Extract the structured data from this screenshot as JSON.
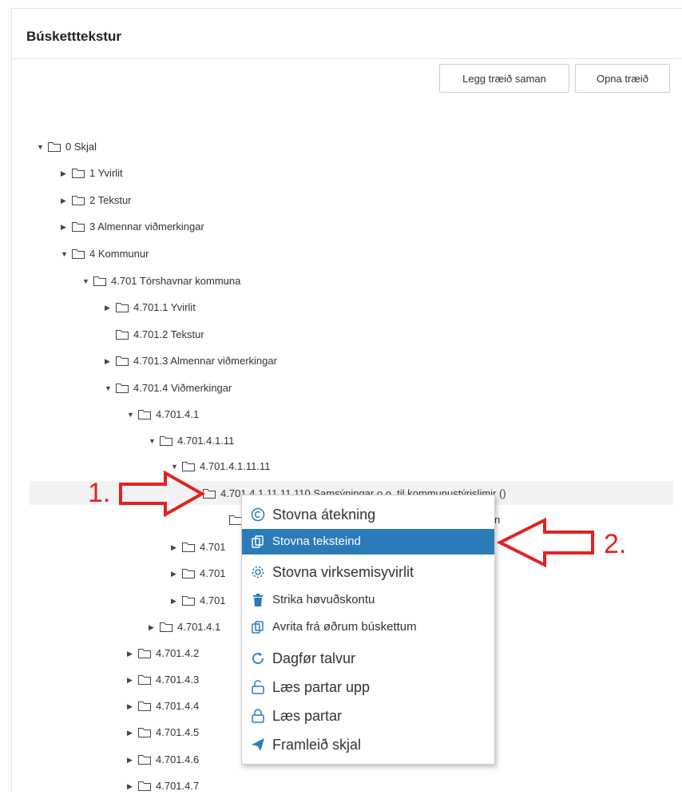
{
  "panel": {
    "title": "Búsketttekstur"
  },
  "toolbar": {
    "collapse_label": "Legg træið saman",
    "open_label": "Opna træið"
  },
  "tree": {
    "n0": "0 Skjal",
    "n1": "1 Yvirlit",
    "n2": "2 Tekstur",
    "n3": "3 Almennar viðmerkingar",
    "n4": "4 Kommunur",
    "n4_701": "4.701 Tórshavnar kommuna",
    "n4_701_1": "4.701.1 Yvirlit",
    "n4_701_2": "4.701.2 Tekstur",
    "n4_701_3": "4.701.3 Almennar viðmerkingar",
    "n4_701_4": "4.701.4 Viðmerkingar",
    "n4_701_4_1": "4.701.4.1",
    "n4_701_4_1_11": "4.701.4.1.11",
    "n4_701_4_1_11_11": "4.701.4.1.11.11",
    "selected": "4.701.4.1.11.11.110 Samsýningar o.o. til kommunustýrislimir ()",
    "child_tail": "n",
    "hidden_a": "4.701",
    "hidden_b": "4.701",
    "hidden_c": "4.701",
    "hidden_d": "4.701.4.1",
    "n4_701_4_2": "4.701.4.2",
    "n4_701_4_3": "4.701.4.3",
    "n4_701_4_4": "4.701.4.4",
    "n4_701_4_5": "4.701.4.5",
    "n4_701_4_6": "4.701.4.6",
    "n4_701_4_7": "4.701.4.7"
  },
  "context_menu": {
    "items": [
      {
        "label": "Stovna átekning",
        "icon": "copyright-icon"
      },
      {
        "label": "Stovna teksteind",
        "icon": "copy-icon"
      },
      {
        "label": "Stovna virksemisyvirlit",
        "icon": "cogs-icon"
      },
      {
        "label": "Strika høvuðskontu",
        "icon": "trash-icon"
      },
      {
        "label": "Avrita frá øðrum búskettum",
        "icon": "copy-icon"
      },
      {
        "label": "Dagfør talvur",
        "icon": "refresh-icon"
      },
      {
        "label": "Læs partar upp",
        "icon": "unlock-icon"
      },
      {
        "label": "Læs partar",
        "icon": "lock-icon"
      },
      {
        "label": "Framleið skjal",
        "icon": "send-icon"
      }
    ]
  },
  "annotations": {
    "step1": "1.",
    "step2": "2."
  },
  "colors": {
    "accent": "#2b7bb9",
    "annotation_red": "#e32222"
  }
}
